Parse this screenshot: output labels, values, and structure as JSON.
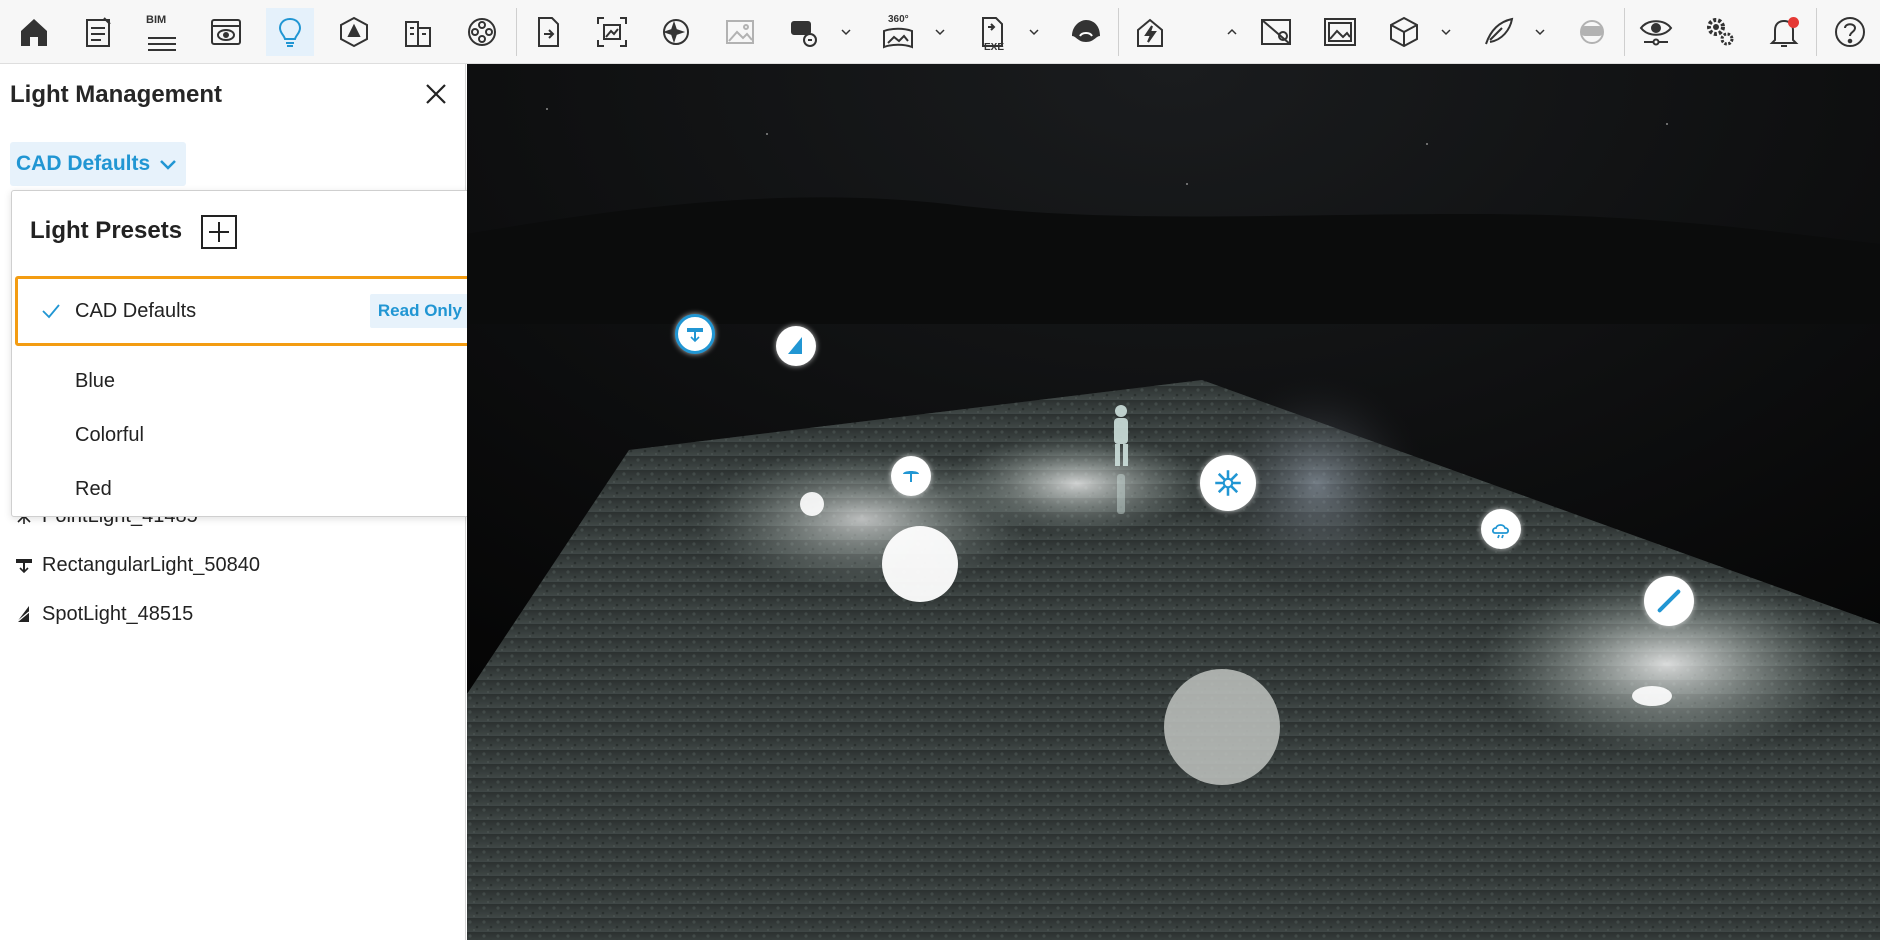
{
  "toolbar": {
    "items": [
      {
        "name": "home-icon"
      },
      {
        "name": "notes-icon"
      },
      {
        "name": "bim-icon",
        "label": "BIM"
      },
      {
        "name": "preview-window-icon"
      },
      {
        "name": "lightbulb-icon",
        "active": true
      },
      {
        "name": "landscape-icon"
      },
      {
        "name": "building-icon"
      },
      {
        "name": "film-reel-icon"
      },
      {
        "name": "export-file-icon"
      },
      {
        "name": "screenshot-icon"
      },
      {
        "name": "ai-sparkle-icon"
      },
      {
        "name": "image-icon",
        "disabled": true
      },
      {
        "name": "video-camera-icon"
      },
      {
        "name": "panorama-360-icon",
        "label": "360°"
      },
      {
        "name": "exe-export-icon",
        "label": "EXE"
      },
      {
        "name": "cloud-render-icon"
      },
      {
        "name": "enscape-live-icon"
      },
      {
        "name": "map-location-icon"
      },
      {
        "name": "image-frame-icon"
      },
      {
        "name": "cube-icon"
      },
      {
        "name": "feather-icon"
      },
      {
        "name": "vr-headset-icon",
        "disabled": true
      },
      {
        "name": "visibility-icon"
      },
      {
        "name": "settings-icon"
      },
      {
        "name": "notifications-icon"
      },
      {
        "name": "help-icon"
      }
    ]
  },
  "panel": {
    "title": "Light Management",
    "preset_selected": "CAD Defaults",
    "lights": [
      {
        "label": "PointLight_41485",
        "icon": "point-light-icon"
      },
      {
        "label": "RectangularLight_50840",
        "icon": "rectangular-light-icon"
      },
      {
        "label": "SpotLight_48515",
        "icon": "spot-light-icon"
      }
    ]
  },
  "dropdown": {
    "title": "Light Presets",
    "options": [
      {
        "label": "CAD Defaults",
        "badge": "Read Only",
        "selected": true
      },
      {
        "label": "Blue"
      },
      {
        "label": "Colorful"
      },
      {
        "label": "Red"
      }
    ]
  },
  "colors": {
    "accent": "#2196d3",
    "selection_border": "#f39c12",
    "notification": "#e53935"
  }
}
